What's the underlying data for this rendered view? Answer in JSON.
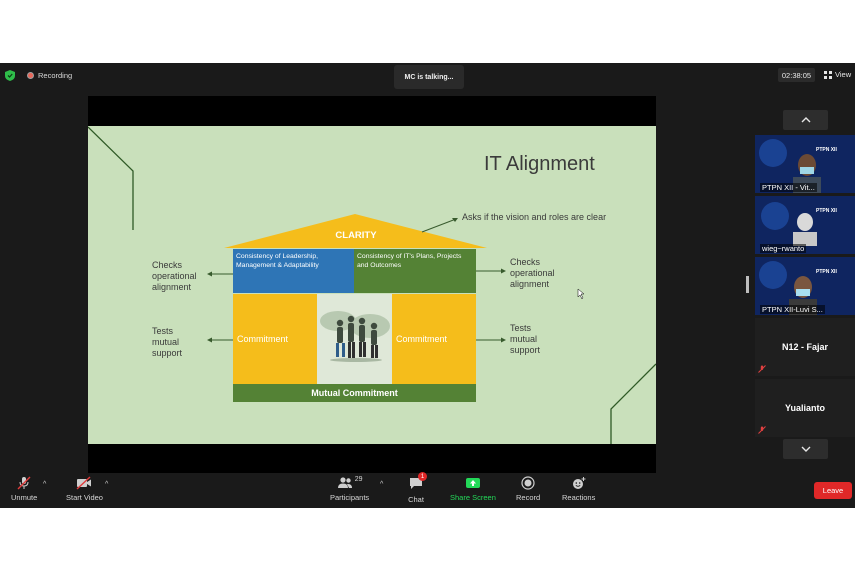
{
  "top_bar": {
    "recording_label": "Recording",
    "talking_label": "MC is talking...",
    "timer": "02:38:05",
    "view_label": "View"
  },
  "slide": {
    "title": "IT Alignment",
    "roof_label": "CLARITY",
    "roof_annotation": "Asks if the vision and roles are clear",
    "left_top_note": [
      "Checks",
      "operational",
      "alignment"
    ],
    "left_bottom_note": [
      "Tests",
      "mutual",
      "support"
    ],
    "right_top_note": [
      "Checks",
      "operational",
      "alignment"
    ],
    "right_bottom_note": [
      "Tests",
      "mutual",
      "support"
    ],
    "block_left": [
      "Consistency of Leadership,",
      "Management & Adaptability"
    ],
    "block_right": [
      "Consistency of IT's Plans, Projects",
      "and Outcomes"
    ],
    "pillar_left": "Commitment",
    "pillar_right": "Commitment",
    "base_label": "Mutual Commitment"
  },
  "participants_panel": {
    "tiles": [
      {
        "name": "PTPN XII - Vit...",
        "type": "video"
      },
      {
        "name": "wieg~rwanto",
        "type": "video"
      },
      {
        "name": "PTPN XII-Luvi S...",
        "type": "video"
      },
      {
        "name": "N12 - Fajar",
        "type": "name"
      },
      {
        "name": "Yualianto",
        "type": "name"
      }
    ],
    "tile_brand": "PTPN XII"
  },
  "toolbar": {
    "unmute_label": "Unmute",
    "start_video_label": "Start Video",
    "participants_label": "Participants",
    "participants_count": "29",
    "chat_label": "Chat",
    "chat_badge": "1",
    "share_screen_label": "Share Screen",
    "record_label": "Record",
    "reactions_label": "Reactions",
    "leave_label": "Leave"
  },
  "colors": {
    "slide_bg": "#c9e0bb",
    "roof": "#f5bd1b",
    "blue_block": "#2e75b6",
    "green_block": "#548235",
    "share_green": "#23d959",
    "leave_red": "#e02828"
  }
}
